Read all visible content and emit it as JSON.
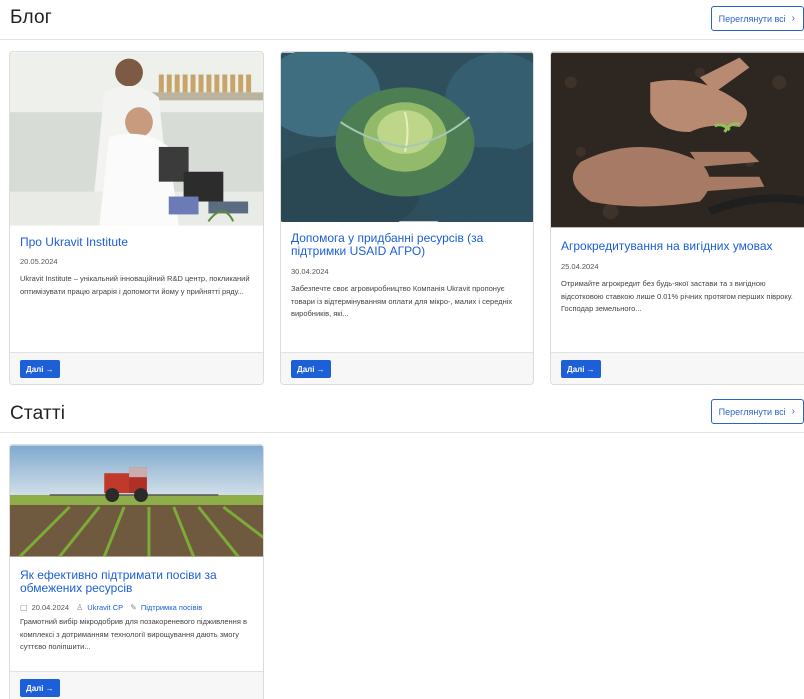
{
  "blog": {
    "title": "Блог",
    "view_all_label": "Переглянути всі",
    "cards": [
      {
        "title": "Про Ukravit Institute",
        "date": "20.05.2024",
        "excerpt": "Ukravit Institute – унікальний інноваційний R&D центр, покликаний оптимізувати працю аграрія і допомогти йому у прийнятті ряду...",
        "button_label": "Далі →"
      },
      {
        "title": "Допомога у придбанні ресурсів (за підтримки USAID АГРО)",
        "date": "30.04.2024",
        "excerpt": "Забезпечте своє агровиробництво Компанія Ukravit пропонує товари із відтермінуванням оплати для мікро-, малих і середніх виробників, які...",
        "button_label": "Далі →"
      },
      {
        "title": "Агрокредитування на вигідних умовах",
        "date": "25.04.2024",
        "excerpt": "Отримайте агрокредит без будь-якої застави та з вигідною відсотковою ставкою лише 0.01% річних протягом перших півроку. Господар земельного...",
        "button_label": "Далі →"
      }
    ]
  },
  "articles": {
    "title": "Статті",
    "view_all_label": "Переглянути всі",
    "cards": [
      {
        "title": "Як ефективно підтримати посіви за обмежених ресурсів",
        "date": "20.04.2024",
        "author": "Ukravit CP",
        "category": "Підтримка посівів",
        "excerpt": "Грамотний вибір мікродобрив для позакореневого підживлення в комплексі з дотриманням технології вирощування дають змогу суттєво поліпшити...",
        "button_label": "Далі →"
      }
    ]
  },
  "icons": {
    "chevron": "chevron-right-icon",
    "calendar": "calendar-icon",
    "user": "user-icon",
    "tag": "tag-icon"
  },
  "colors": {
    "accent": "#1c5fd6",
    "border": "#dcdcdc",
    "footer_bg": "#f7f7f7"
  }
}
